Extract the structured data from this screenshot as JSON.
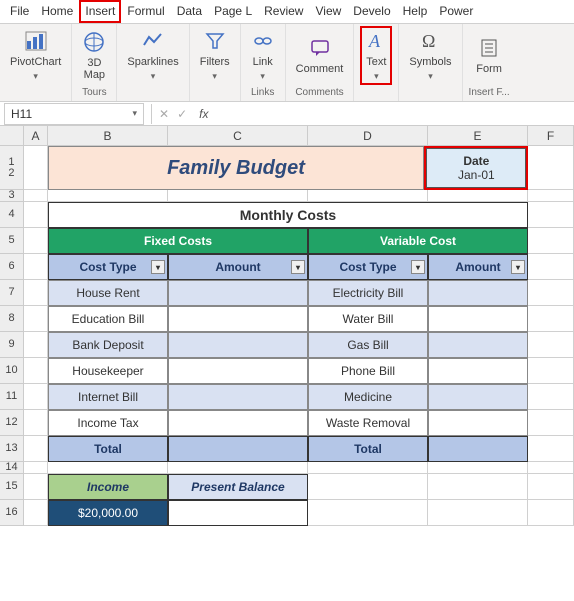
{
  "tabs": {
    "file": "File",
    "home": "Home",
    "insert": "Insert",
    "formulas": "Formul",
    "data": "Data",
    "page": "Page L",
    "review": "Review",
    "view": "View",
    "developer": "Develo",
    "help": "Help",
    "power": "Power"
  },
  "ribbon": {
    "pivotchart": "PivotChart",
    "map3d": "3D\nMap",
    "tours": "Tours",
    "sparklines": "Sparklines",
    "filters": "Filters",
    "link": "Link",
    "links": "Links",
    "comment": "Comment",
    "comments": "Comments",
    "text": "Text",
    "symbols": "Symbols",
    "form": "Form",
    "insertf": "Insert F..."
  },
  "namebox": "H11",
  "title": "Family Budget",
  "date": {
    "label": "Date",
    "value": "Jan-01"
  },
  "table": {
    "monthly": "Monthly Costs",
    "fixed": "Fixed Costs",
    "variable": "Variable Cost",
    "cost_type": "Cost Type",
    "amount": "Amount",
    "total": "Total",
    "fixed_rows": [
      "House Rent",
      "Education Bill",
      "Bank Deposit",
      "Housekeeper",
      "Internet Bill",
      "Income Tax"
    ],
    "variable_rows": [
      "Electricity Bill",
      "Water Bill",
      "Gas Bill",
      "Phone Bill",
      "Medicine",
      "Waste Removal"
    ]
  },
  "income": {
    "label": "Income",
    "value": "$20,000.00",
    "balance": "Present Balance"
  },
  "cols": {
    "A": "A",
    "B": "B",
    "C": "C",
    "D": "D",
    "E": "E",
    "F": "F"
  },
  "rows": [
    "1",
    "2",
    "3",
    "4",
    "5",
    "6",
    "7",
    "8",
    "9",
    "10",
    "11",
    "12",
    "13",
    "14",
    "15",
    "16"
  ]
}
